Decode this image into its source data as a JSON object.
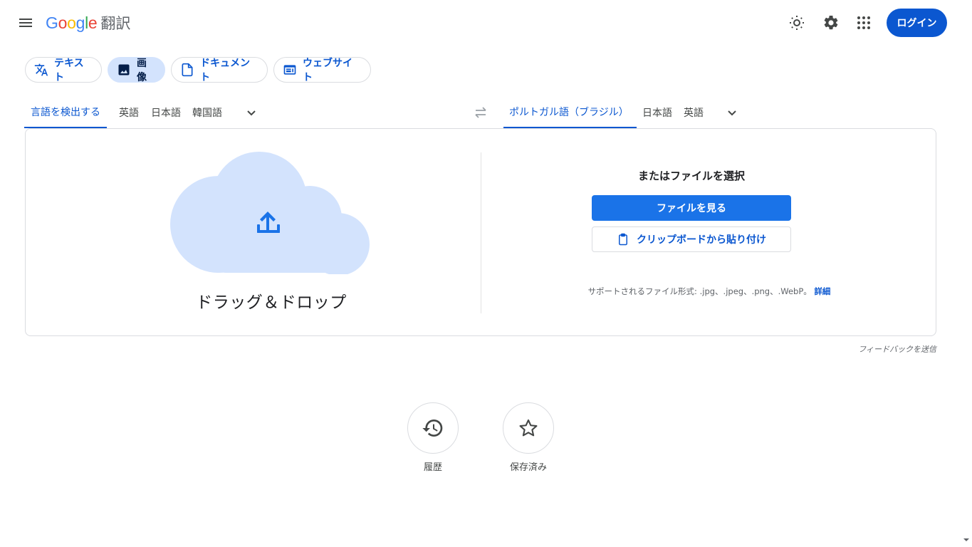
{
  "header": {
    "logo_letters": [
      "G",
      "o",
      "o",
      "g",
      "l",
      "e"
    ],
    "product_name": "翻訳",
    "login_label": "ログイン",
    "icons": [
      "menu-icon",
      "theme-icon",
      "settings-icon",
      "apps-icon"
    ]
  },
  "modes": [
    {
      "label": "テキスト",
      "icon": "translate-icon",
      "active": false
    },
    {
      "label": "画像",
      "icon": "image-icon",
      "active": true
    },
    {
      "label": "ドキュメント",
      "icon": "document-icon",
      "active": false
    },
    {
      "label": "ウェブサイト",
      "icon": "website-icon",
      "active": false
    }
  ],
  "source_langs": [
    "言語を検出する",
    "英語",
    "日本語",
    "韓国語"
  ],
  "target_langs": [
    "ポルトガル語（ブラジル）",
    "日本語",
    "英語"
  ],
  "upload": {
    "drop_label": "ドラッグ＆ドロップ",
    "or_label": "またはファイルを選択",
    "browse_label": "ファイルを見る",
    "paste_label": "クリップボードから貼り付け",
    "support_text": "サポートされるファイル形式: .jpg、.jpeg、.png、.WebP。",
    "support_link": "詳細"
  },
  "feedback_label": "フィードバックを送信",
  "actions": {
    "history_label": "履歴",
    "saved_label": "保存済み"
  },
  "colors": {
    "accent": "#0b57d0",
    "primary_button": "#1a73e8",
    "active_chip": "#d3e3fd",
    "cloud": "#d3e3fd"
  }
}
